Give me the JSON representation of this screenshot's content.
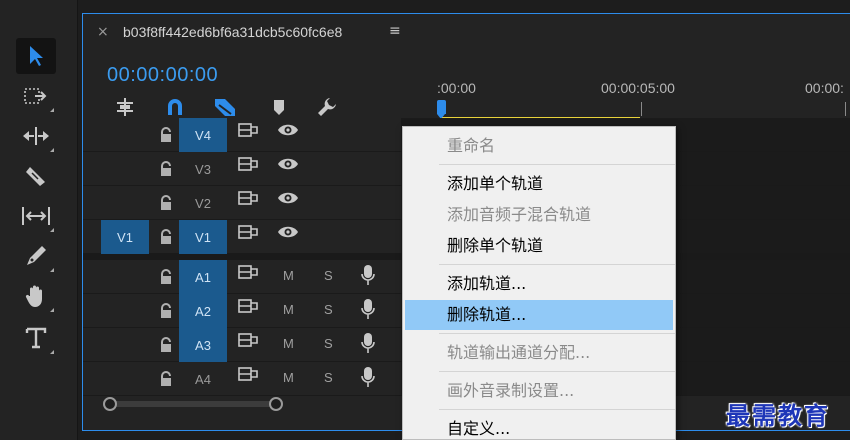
{
  "tools": [
    "selection-tool",
    "track-select-tool",
    "ripple-edit-tool",
    "razor-tool",
    "slip-tool",
    "pen-tool",
    "hand-tool",
    "type-tool"
  ],
  "timeline": {
    "close_glyph": "×",
    "sequence_name": "b03f8ff442ed6bf6a31dcb5c60fc6e8",
    "menu_glyph": "≡",
    "timecode": "00:00:00:00",
    "ruler": [
      ":00:00",
      "00:00:05:00",
      "00:00:"
    ],
    "tracks": [
      {
        "target": "V4",
        "targeted": true,
        "type": "video"
      },
      {
        "target": "V3",
        "targeted": false,
        "type": "video"
      },
      {
        "target": "V2",
        "targeted": false,
        "type": "video"
      },
      {
        "source": "V1",
        "target": "V1",
        "targeted": true,
        "type": "video"
      },
      {
        "target": "A1",
        "targeted": true,
        "type": "audio",
        "mute": "M",
        "solo": "S"
      },
      {
        "target": "A2",
        "targeted": true,
        "type": "audio",
        "mute": "M",
        "solo": "S"
      },
      {
        "target": "A3",
        "targeted": true,
        "type": "audio",
        "mute": "M",
        "solo": "S"
      },
      {
        "target": "A4",
        "targeted": false,
        "type": "audio",
        "mute": "M",
        "solo": "S"
      }
    ],
    "accent": "#2d8ceb"
  },
  "context_menu": {
    "items": [
      {
        "label": "重命名",
        "disabled": true
      },
      {
        "label": "添加单个轨道",
        "disabled": false
      },
      {
        "label": "添加音频子混合轨道",
        "disabled": true
      },
      {
        "label": "删除单个轨道",
        "disabled": false
      },
      {
        "label": "添加轨道...",
        "disabled": false
      },
      {
        "label": "删除轨道...",
        "disabled": false,
        "highlighted": true
      },
      {
        "label": "轨道输出通道分配...",
        "disabled": true
      },
      {
        "label": "画外音录制设置...",
        "disabled": true
      },
      {
        "label": "自定义...",
        "disabled": false
      }
    ]
  },
  "watermark": "最需教育"
}
